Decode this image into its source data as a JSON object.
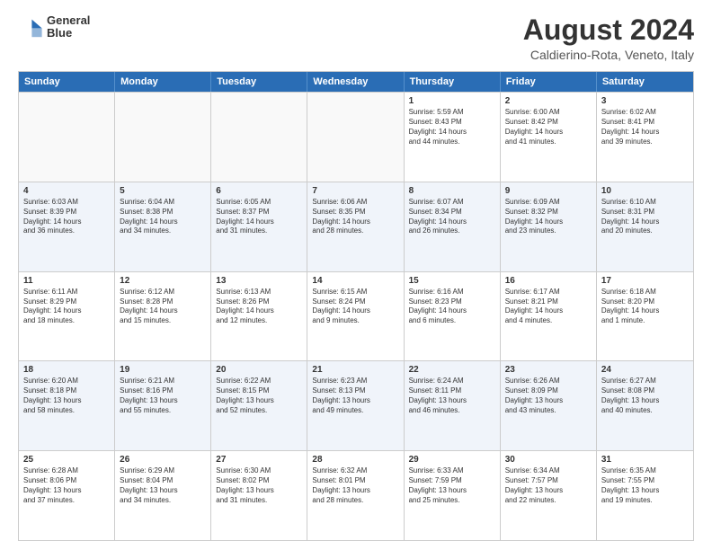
{
  "logo": {
    "line1": "General",
    "line2": "Blue"
  },
  "title": "August 2024",
  "subtitle": "Caldierino-Rota, Veneto, Italy",
  "calendar": {
    "headers": [
      "Sunday",
      "Monday",
      "Tuesday",
      "Wednesday",
      "Thursday",
      "Friday",
      "Saturday"
    ],
    "rows": [
      [
        {
          "day": "",
          "content": ""
        },
        {
          "day": "",
          "content": ""
        },
        {
          "day": "",
          "content": ""
        },
        {
          "day": "",
          "content": ""
        },
        {
          "day": "1",
          "content": "Sunrise: 5:59 AM\nSunset: 8:43 PM\nDaylight: 14 hours\nand 44 minutes."
        },
        {
          "day": "2",
          "content": "Sunrise: 6:00 AM\nSunset: 8:42 PM\nDaylight: 14 hours\nand 41 minutes."
        },
        {
          "day": "3",
          "content": "Sunrise: 6:02 AM\nSunset: 8:41 PM\nDaylight: 14 hours\nand 39 minutes."
        }
      ],
      [
        {
          "day": "4",
          "content": "Sunrise: 6:03 AM\nSunset: 8:39 PM\nDaylight: 14 hours\nand 36 minutes."
        },
        {
          "day": "5",
          "content": "Sunrise: 6:04 AM\nSunset: 8:38 PM\nDaylight: 14 hours\nand 34 minutes."
        },
        {
          "day": "6",
          "content": "Sunrise: 6:05 AM\nSunset: 8:37 PM\nDaylight: 14 hours\nand 31 minutes."
        },
        {
          "day": "7",
          "content": "Sunrise: 6:06 AM\nSunset: 8:35 PM\nDaylight: 14 hours\nand 28 minutes."
        },
        {
          "day": "8",
          "content": "Sunrise: 6:07 AM\nSunset: 8:34 PM\nDaylight: 14 hours\nand 26 minutes."
        },
        {
          "day": "9",
          "content": "Sunrise: 6:09 AM\nSunset: 8:32 PM\nDaylight: 14 hours\nand 23 minutes."
        },
        {
          "day": "10",
          "content": "Sunrise: 6:10 AM\nSunset: 8:31 PM\nDaylight: 14 hours\nand 20 minutes."
        }
      ],
      [
        {
          "day": "11",
          "content": "Sunrise: 6:11 AM\nSunset: 8:29 PM\nDaylight: 14 hours\nand 18 minutes."
        },
        {
          "day": "12",
          "content": "Sunrise: 6:12 AM\nSunset: 8:28 PM\nDaylight: 14 hours\nand 15 minutes."
        },
        {
          "day": "13",
          "content": "Sunrise: 6:13 AM\nSunset: 8:26 PM\nDaylight: 14 hours\nand 12 minutes."
        },
        {
          "day": "14",
          "content": "Sunrise: 6:15 AM\nSunset: 8:24 PM\nDaylight: 14 hours\nand 9 minutes."
        },
        {
          "day": "15",
          "content": "Sunrise: 6:16 AM\nSunset: 8:23 PM\nDaylight: 14 hours\nand 6 minutes."
        },
        {
          "day": "16",
          "content": "Sunrise: 6:17 AM\nSunset: 8:21 PM\nDaylight: 14 hours\nand 4 minutes."
        },
        {
          "day": "17",
          "content": "Sunrise: 6:18 AM\nSunset: 8:20 PM\nDaylight: 14 hours\nand 1 minute."
        }
      ],
      [
        {
          "day": "18",
          "content": "Sunrise: 6:20 AM\nSunset: 8:18 PM\nDaylight: 13 hours\nand 58 minutes."
        },
        {
          "day": "19",
          "content": "Sunrise: 6:21 AM\nSunset: 8:16 PM\nDaylight: 13 hours\nand 55 minutes."
        },
        {
          "day": "20",
          "content": "Sunrise: 6:22 AM\nSunset: 8:15 PM\nDaylight: 13 hours\nand 52 minutes."
        },
        {
          "day": "21",
          "content": "Sunrise: 6:23 AM\nSunset: 8:13 PM\nDaylight: 13 hours\nand 49 minutes."
        },
        {
          "day": "22",
          "content": "Sunrise: 6:24 AM\nSunset: 8:11 PM\nDaylight: 13 hours\nand 46 minutes."
        },
        {
          "day": "23",
          "content": "Sunrise: 6:26 AM\nSunset: 8:09 PM\nDaylight: 13 hours\nand 43 minutes."
        },
        {
          "day": "24",
          "content": "Sunrise: 6:27 AM\nSunset: 8:08 PM\nDaylight: 13 hours\nand 40 minutes."
        }
      ],
      [
        {
          "day": "25",
          "content": "Sunrise: 6:28 AM\nSunset: 8:06 PM\nDaylight: 13 hours\nand 37 minutes."
        },
        {
          "day": "26",
          "content": "Sunrise: 6:29 AM\nSunset: 8:04 PM\nDaylight: 13 hours\nand 34 minutes."
        },
        {
          "day": "27",
          "content": "Sunrise: 6:30 AM\nSunset: 8:02 PM\nDaylight: 13 hours\nand 31 minutes."
        },
        {
          "day": "28",
          "content": "Sunrise: 6:32 AM\nSunset: 8:01 PM\nDaylight: 13 hours\nand 28 minutes."
        },
        {
          "day": "29",
          "content": "Sunrise: 6:33 AM\nSunset: 7:59 PM\nDaylight: 13 hours\nand 25 minutes."
        },
        {
          "day": "30",
          "content": "Sunrise: 6:34 AM\nSunset: 7:57 PM\nDaylight: 13 hours\nand 22 minutes."
        },
        {
          "day": "31",
          "content": "Sunrise: 6:35 AM\nSunset: 7:55 PM\nDaylight: 13 hours\nand 19 minutes."
        }
      ]
    ]
  }
}
